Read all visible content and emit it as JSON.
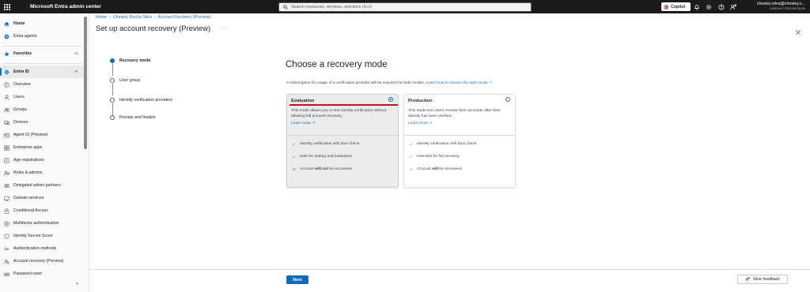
{
  "topbar": {
    "app_title": "Microsoft Entra admin center",
    "search_placeholder": "Search resources, services, and docs (G+/)",
    "copilot_label": "Copilot",
    "account_email": "chesley.silva@chesley.c...",
    "account_tenant": "CHESLEY ROCHA SILVA"
  },
  "sidebar": {
    "home": "Home",
    "entra_agents": "Entra agents",
    "favorites": "Favorites",
    "entra_id": "Entra ID",
    "items": [
      {
        "label": "Overview",
        "icon": "info-icon"
      },
      {
        "label": "Users",
        "icon": "user-icon"
      },
      {
        "label": "Groups",
        "icon": "groups-icon"
      },
      {
        "label": "Devices",
        "icon": "devices-icon"
      },
      {
        "label": "Agent ID (Preview)",
        "icon": "agent-id-icon"
      },
      {
        "label": "Enterprise apps",
        "icon": "enterprise-apps-icon"
      },
      {
        "label": "App registrations",
        "icon": "app-registrations-icon"
      },
      {
        "label": "Roles & admins",
        "icon": "roles-icon"
      },
      {
        "label": "Delegated admin partners",
        "icon": "partners-icon"
      },
      {
        "label": "Domain services",
        "icon": "domain-icon"
      },
      {
        "label": "Conditional Access",
        "icon": "conditional-access-icon"
      },
      {
        "label": "Multifactor authentication",
        "icon": "mfa-icon"
      },
      {
        "label": "Identity Secure Score",
        "icon": "secure-score-icon"
      },
      {
        "label": "Authentication methods",
        "icon": "auth-methods-icon"
      },
      {
        "label": "Account recovery (Preview)",
        "icon": "account-recovery-icon"
      },
      {
        "label": "Password reset",
        "icon": "password-reset-icon"
      }
    ],
    "collapse_glyph": "«"
  },
  "breadcrumb": [
    "Home",
    "Chesley Rocha Silva",
    "Account Recovery (Preview)"
  ],
  "page": {
    "title": "Set up account recovery (Preview)",
    "more": "···"
  },
  "steps": [
    {
      "label": "Recovery mode",
      "state": "current"
    },
    {
      "label": "User group",
      "state": "pending"
    },
    {
      "label": "Identity verification providers",
      "state": "pending"
    },
    {
      "label": "Review and finalize",
      "state": "pending"
    }
  ],
  "content": {
    "title": "Choose a recovery mode",
    "desc": "A subscription for usage of a verification provider will be required for both modes.",
    "desc_link": "Learn how to choose the right mode ↗"
  },
  "cards": {
    "evaluation": {
      "title": "Evaluation",
      "selected": true,
      "desc": "This mode allows you to test identity verification without allowing full account recovery.",
      "link": "Learn more ↗",
      "features": [
        {
          "prefix": "Identity verification with face check",
          "strong": "",
          "suffix": "",
          "icon": "check-icon"
        },
        {
          "prefix": "Safe for testing and evaluation",
          "strong": "",
          "suffix": "",
          "icon": "check-icon"
        },
        {
          "prefix": "Account ",
          "strong": "will not",
          "suffix": " be recovered",
          "icon": "x-icon"
        }
      ]
    },
    "production": {
      "title": "Production",
      "selected": false,
      "desc": "This mode lets users recover their accounts after their identity has been verified.",
      "link": "Learn more ↗",
      "features": [
        {
          "prefix": "Identity verification with face check",
          "strong": "",
          "suffix": "",
          "icon": "check-icon"
        },
        {
          "prefix": "Intended for full recovery",
          "strong": "",
          "suffix": "",
          "icon": "check-icon"
        },
        {
          "prefix": "Account ",
          "strong": "will",
          "suffix": " be recovered",
          "icon": "check-icon"
        }
      ]
    }
  },
  "footer": {
    "next_label": "Next",
    "feedback_label": "Give feedback"
  },
  "colors": {
    "accent": "#0f6cbd",
    "topbar": "#1b1b1b",
    "highlight_underline": "#c50f1f"
  }
}
